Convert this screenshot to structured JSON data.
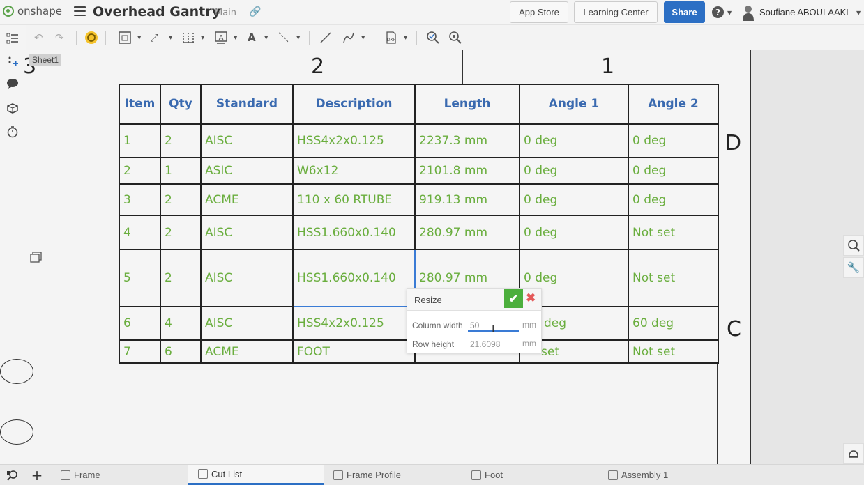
{
  "app": {
    "brand": "onshape",
    "document_title": "Overhead Gantry",
    "branch": "Main"
  },
  "header_buttons": {
    "app_store": "App Store",
    "learning_center": "Learning Center",
    "share": "Share"
  },
  "user": {
    "name": "Soufiane ABOULAAKL"
  },
  "sheet": {
    "name": "Sheet1"
  },
  "zones": {
    "col2": "2",
    "col1": "1",
    "rowD": "D",
    "rowC": "C",
    "col3": "3"
  },
  "table": {
    "headers": [
      "Item",
      "Qty",
      "Standard",
      "Description",
      "Length",
      "Angle 1",
      "Angle 2"
    ],
    "rows": [
      [
        "1",
        "2",
        "AISC",
        "HSS4x2x0.125",
        "2237.3 mm",
        "0 deg",
        "0 deg"
      ],
      [
        "2",
        "1",
        "ASIC",
        "W6x12",
        "2101.8 mm",
        "0 deg",
        "0 deg"
      ],
      [
        "3",
        "2",
        "ACME",
        "110 x 60 RTUBE",
        "919.13 mm",
        "0 deg",
        "0 deg"
      ],
      [
        "4",
        "2",
        "AISC",
        "HSS1.660x0.140",
        "280.97 mm",
        "0 deg",
        "Not set"
      ],
      [
        "5",
        "2",
        "AISC",
        "HSS1.660x0.140",
        "280.97 mm",
        "0 deg",
        "Not set"
      ],
      [
        "6",
        "4",
        "AISC",
        "HSS4x2x0.125",
        "",
        "deg",
        "60 deg"
      ],
      [
        "7",
        "6",
        "ACME",
        "FOOT",
        "",
        "set",
        "Not set"
      ]
    ]
  },
  "resize_dialog": {
    "title": "Resize",
    "column_width_label": "Column width",
    "column_width_value": "50",
    "row_height_label": "Row height",
    "row_height_value": "21.6098",
    "unit": "mm"
  },
  "tabs": [
    {
      "label": "Frame",
      "active": false
    },
    {
      "label": "Cut List",
      "active": true
    },
    {
      "label": "Frame Profile",
      "active": false
    },
    {
      "label": "Foot",
      "active": false
    },
    {
      "label": "Assembly 1",
      "active": false
    }
  ],
  "colors": {
    "accent": "#2c6fc4",
    "header_text": "#3a6ab0",
    "cell_text": "#6aae3e",
    "ok_green": "#4caf3d"
  }
}
